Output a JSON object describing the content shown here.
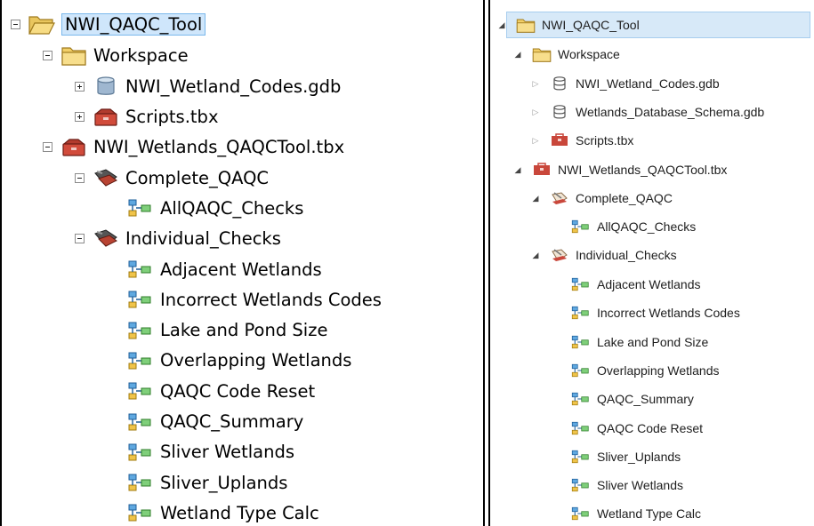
{
  "left_tree": {
    "root": "NWI_QAQC_Tool",
    "workspace": "Workspace",
    "gdb": "NWI_Wetland_Codes.gdb",
    "scripts": "Scripts.tbx",
    "toolbox": "NWI_Wetlands_QAQCTool.tbx",
    "complete": "Complete_QAQC",
    "allqaqc": "AllQAQC_Checks",
    "individual": "Individual_Checks",
    "tools": [
      "Adjacent Wetlands",
      "Incorrect Wetlands Codes",
      "Lake and Pond Size",
      "Overlapping Wetlands",
      "QAQC Code Reset",
      "QAQC_Summary",
      "Sliver Wetlands",
      "Sliver_Uplands",
      "Wetland Type Calc"
    ]
  },
  "right_tree": {
    "root": "NWI_QAQC_Tool",
    "workspace": "Workspace",
    "gdb1": "NWI_Wetland_Codes.gdb",
    "gdb2": "Wetlands_Database_Schema.gdb",
    "scripts": "Scripts.tbx",
    "toolbox": "NWI_Wetlands_QAQCTool.tbx",
    "complete": "Complete_QAQC",
    "allqaqc": "AllQAQC_Checks",
    "individual": "Individual_Checks",
    "tools": [
      "Adjacent Wetlands",
      "Incorrect Wetlands Codes",
      "Lake and Pond Size",
      "Overlapping Wetlands",
      "QAQC_Summary",
      "QAQC Code Reset",
      "Sliver_Uplands",
      "Sliver Wetlands",
      "Wetland Type Calc"
    ]
  },
  "colors": {
    "selection": "#cfe6fb",
    "folder": "#e8c25a",
    "toolbox": "#c0392b"
  }
}
